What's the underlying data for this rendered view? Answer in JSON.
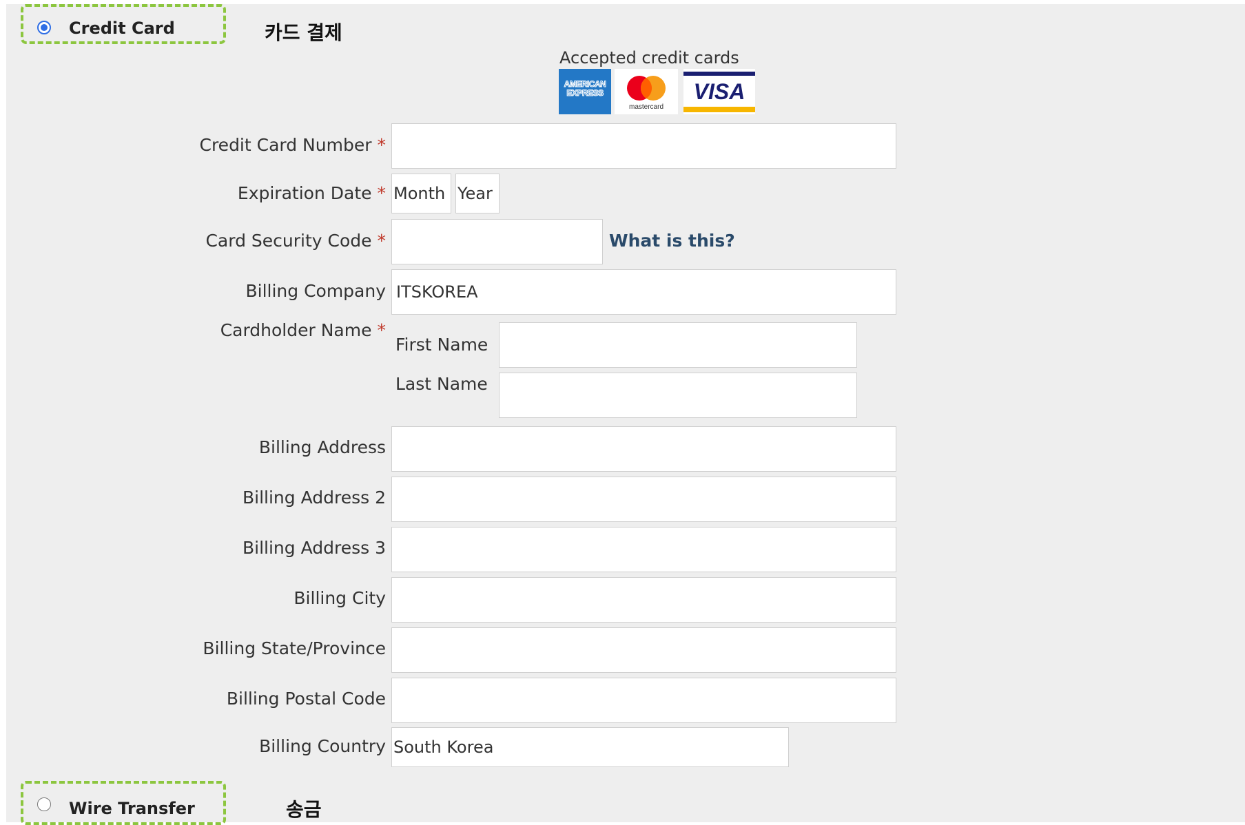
{
  "payment_methods": {
    "credit_card": {
      "label": "Credit Card",
      "note": "카드 결제",
      "selected": true
    },
    "wire_transfer": {
      "label": "Wire Transfer",
      "note": "송금",
      "selected": false
    }
  },
  "accepted_cards": {
    "title": "Accepted credit cards",
    "logos": [
      {
        "icon": "amex-logo-icon",
        "text": "AMERICAN EXPRESS",
        "color": "#2378C6"
      },
      {
        "icon": "mastercard-logo-icon",
        "text": "mastercard",
        "colors": [
          "#EB001B",
          "#F79E1B"
        ]
      },
      {
        "icon": "visa-logo-icon",
        "text": "VISA",
        "colors": [
          "#1A1F71",
          "#F7B600"
        ]
      }
    ]
  },
  "form": {
    "required_mark": "*",
    "card_number": {
      "label": "Credit Card Number",
      "value": ""
    },
    "expiration": {
      "label": "Expiration Date",
      "month": "Month",
      "year": "Year"
    },
    "security_code": {
      "label": "Card Security Code",
      "value": "",
      "help_link": "What is this?"
    },
    "billing_company": {
      "label": "Billing Company",
      "value": "ITSKOREA"
    },
    "cardholder": {
      "label": "Cardholder Name",
      "first_label": "First Name",
      "first_value": "",
      "last_label": "Last Name",
      "last_value": ""
    },
    "billing_address": {
      "label": "Billing Address",
      "value": ""
    },
    "billing_address_2": {
      "label": "Billing Address 2",
      "value": ""
    },
    "billing_address_3": {
      "label": "Billing Address 3",
      "value": ""
    },
    "billing_city": {
      "label": "Billing City",
      "value": ""
    },
    "billing_state": {
      "label": "Billing State/Province",
      "value": ""
    },
    "billing_postal": {
      "label": "Billing Postal Code",
      "value": ""
    },
    "billing_country": {
      "label": "Billing Country",
      "value": "South Korea"
    }
  },
  "colors": {
    "panel_bg": "#EEEEEE",
    "highlight_dash": "#8CC63F",
    "radio_selected": "#2F6EE5",
    "required": "#C0392B",
    "link": "#2A4A6A"
  }
}
